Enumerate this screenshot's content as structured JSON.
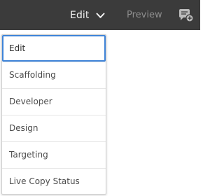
{
  "header": {
    "mode_label": "Edit",
    "mode_chevron_icon": "chevron-down-icon",
    "preview_label": "Preview",
    "side_icon": "comment-add-icon"
  },
  "menu": {
    "selected_index": 0,
    "items": [
      {
        "label": "Edit"
      },
      {
        "label": "Scaffolding"
      },
      {
        "label": "Developer"
      },
      {
        "label": "Design"
      },
      {
        "label": "Targeting"
      },
      {
        "label": "Live Copy Status"
      }
    ]
  },
  "colors": {
    "topbar_bg": "#3b3b3b",
    "accent_focus": "#3f84d8",
    "menu_text": "#4b4b4b",
    "preview_text": "#8e8e8e"
  }
}
